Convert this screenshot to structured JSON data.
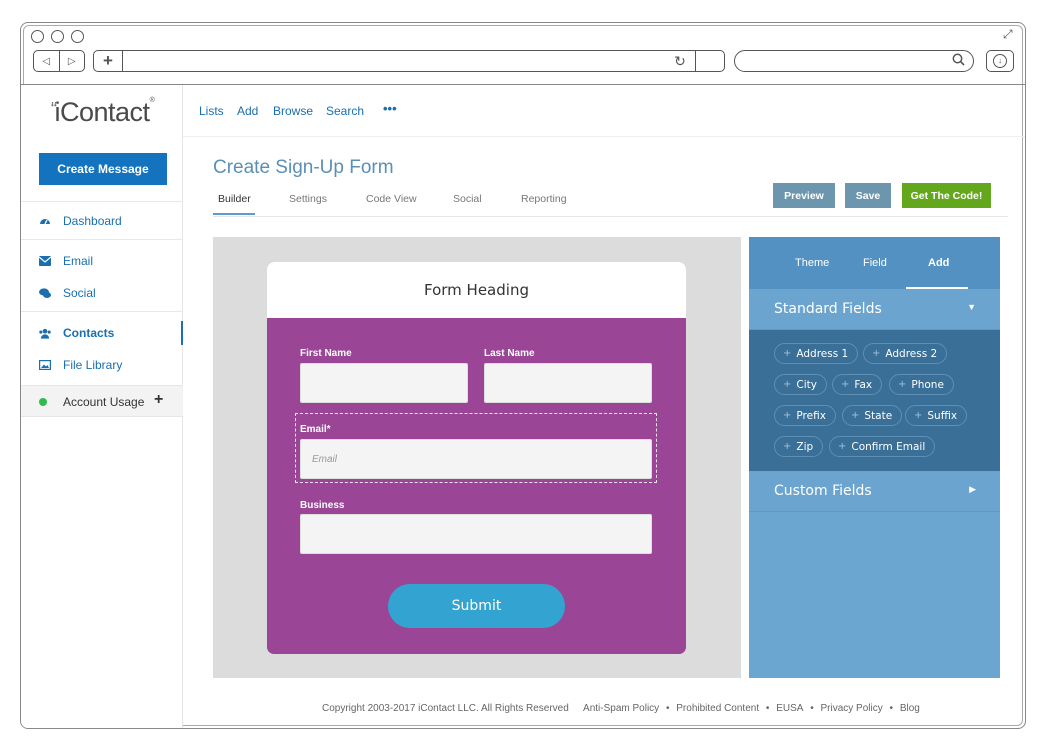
{
  "app": {
    "logo": "iContact"
  },
  "sidebar": {
    "create_button": "Create Message",
    "items": [
      {
        "label": "Dashboard",
        "icon": "dashboard-icon"
      },
      {
        "label": "Email",
        "icon": "envelope-icon"
      },
      {
        "label": "Social",
        "icon": "chat-icon"
      },
      {
        "label": "Contacts",
        "icon": "users-icon"
      },
      {
        "label": "File Library",
        "icon": "image-icon"
      }
    ],
    "account_usage": "Account Usage"
  },
  "topmenu": {
    "items": [
      "Lists",
      "Add",
      "Browse",
      "Search"
    ],
    "more": "•••"
  },
  "page": {
    "title": "Create Sign-Up Form",
    "tabs": [
      "Builder",
      "Settings",
      "Code View",
      "Social",
      "Reporting"
    ],
    "active_tab": "Builder",
    "buttons": {
      "preview": "Preview",
      "save": "Save",
      "get_code": "Get The Code!"
    }
  },
  "form": {
    "heading": "Form Heading",
    "first_name_label": "First Name",
    "last_name_label": "Last Name",
    "email_label": "Email*",
    "email_placeholder": "Email",
    "business_label": "Business",
    "submit": "Submit",
    "colors": {
      "background": "#9a4595",
      "submit": "#33a4d2"
    }
  },
  "panel": {
    "tabs": [
      "Theme",
      "Field",
      "Add"
    ],
    "active_tab": "Add",
    "standard_fields_title": "Standard Fields",
    "standard_fields": [
      "Address 1",
      "Address 2",
      "City",
      "Fax",
      "Phone",
      "Prefix",
      "State",
      "Suffix",
      "Zip",
      "Confirm Email"
    ],
    "custom_fields_title": "Custom Fields"
  },
  "footer": {
    "copyright": "Copyright 2003-2017 iContact LLC. All Rights Reserved",
    "links": [
      "Anti-Spam Policy",
      "Prohibited Content",
      "EUSA",
      "Privacy Policy",
      "Blog"
    ],
    "separator": "•"
  }
}
